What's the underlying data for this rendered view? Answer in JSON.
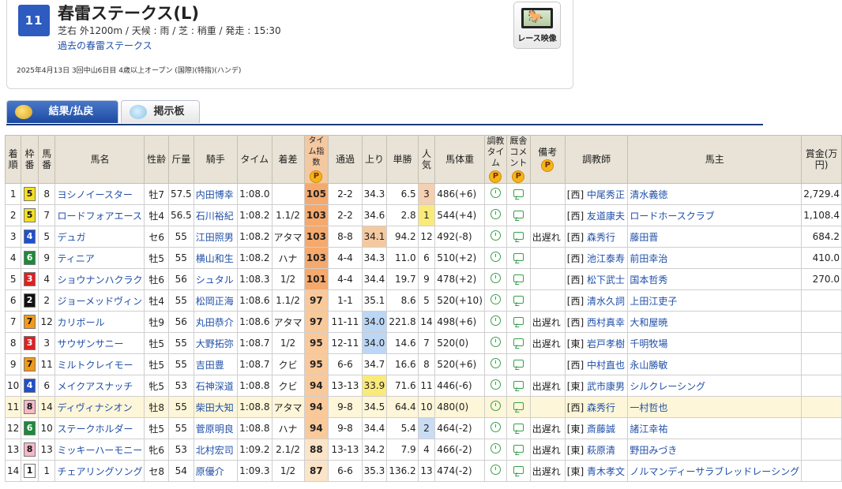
{
  "race": {
    "number": "11 R",
    "title": "春雷ステークス(L)",
    "info": "芝右 外1200m / 天候 : 雨 / 芝 : 稍重 / 発走 : 15:30",
    "past_link": "過去の春雷ステークス",
    "detail": "2025年4月13日  3回中山6日目  4歳以上オープン  (国際)(特指)(ハンデ)",
    "video_label": "レース映像"
  },
  "tabs": [
    {
      "label": "結果/払戻",
      "icon": "coin-icon",
      "active": true
    },
    {
      "label": "掲示板",
      "icon": "speech-bubble-icon",
      "active": false
    }
  ],
  "headers": {
    "rank": "着順",
    "waku": "枠番",
    "umaban": "馬番",
    "horse": "馬名",
    "sexage": "性齢",
    "weight": "斤量",
    "jockey": "騎手",
    "time": "タイム",
    "margin": "着差",
    "index": "タイム指数",
    "passing": "通過",
    "last3f": "上り",
    "odds": "単勝",
    "pop": "人気",
    "bodyweight": "馬体重",
    "train_time": "調教タイム",
    "stable_comment": "厩舎コメント",
    "note": "備考",
    "trainer": "調教師",
    "owner": "馬主",
    "prize": "賞金(万円)",
    "p": "P"
  },
  "colors": {
    "waku": {
      "1": "#ffffff",
      "2": "#111111",
      "3": "#e02020",
      "4": "#1f4fd0",
      "5": "#f5e020",
      "6": "#1b8a3a",
      "7": "#f39a18",
      "8": "#f6b8c8"
    },
    "waku_text": {
      "1": "#111111",
      "2": "#ffffff",
      "3": "#ffffff",
      "4": "#ffffff",
      "5": "#111111",
      "6": "#ffffff",
      "7": "#111111",
      "8": "#111111"
    },
    "index_top": "#f6a96c",
    "index_mid": "#f9c99a",
    "index_low": "#fbe4c7",
    "last3f_fast": "#bcd6f5",
    "last3f_slow": "#f4c9a0",
    "pop1": "#faea7a",
    "pop2": "#c9dcf4",
    "pop3": "#f4cfb0"
  },
  "rows": [
    {
      "rank": "1",
      "waku": "5",
      "num": "8",
      "horse": "ヨシノイースター",
      "sex": "牡7",
      "w": "57.5",
      "jockey": "内田博幸",
      "time": "1:08.0",
      "margin": "",
      "idx": "105",
      "pass": "2-2",
      "l3f": "34.3",
      "odds": "6.5",
      "pop": "3",
      "bw": "486(+6)",
      "tt": true,
      "note": "",
      "region": "[西]",
      "trainer": "中尾秀正",
      "owner": "清水義徳",
      "prize": "2,729.4"
    },
    {
      "rank": "2",
      "waku": "5",
      "num": "7",
      "horse": "ロードフォアエース",
      "sex": "牡4",
      "w": "56.5",
      "jockey": "石川裕紀",
      "time": "1:08.2",
      "margin": "1.1/2",
      "idx": "103",
      "pass": "2-2",
      "l3f": "34.6",
      "odds": "2.8",
      "pop": "1",
      "bw": "544(+4)",
      "tt": true,
      "note": "",
      "region": "[西]",
      "trainer": "友道康夫",
      "owner": "ロードホースクラブ",
      "prize": "1,108.4"
    },
    {
      "rank": "3",
      "waku": "4",
      "num": "5",
      "horse": "デュガ",
      "sex": "セ6",
      "w": "55",
      "jockey": "江田照男",
      "time": "1:08.2",
      "margin": "アタマ",
      "idx": "103",
      "pass": "8-8",
      "l3f": "34.1",
      "odds": "94.2",
      "pop": "12",
      "bw": "492(-8)",
      "tt": true,
      "note": "出遅れ",
      "region": "[西]",
      "trainer": "森秀行",
      "owner": "藤田晋",
      "prize": "684.2"
    },
    {
      "rank": "4",
      "waku": "6",
      "num": "9",
      "horse": "ティニア",
      "sex": "牡5",
      "w": "55",
      "jockey": "横山和生",
      "time": "1:08.2",
      "margin": "ハナ",
      "idx": "103",
      "pass": "4-4",
      "l3f": "34.3",
      "odds": "11.0",
      "pop": "6",
      "bw": "510(+2)",
      "tt": true,
      "note": "",
      "region": "[西]",
      "trainer": "池江泰寿",
      "owner": "前田幸治",
      "prize": "410.0"
    },
    {
      "rank": "5",
      "waku": "3",
      "num": "4",
      "horse": "ショウナンハクラク",
      "sex": "牡6",
      "w": "56",
      "jockey": "シュタル",
      "time": "1:08.3",
      "margin": "1/2",
      "idx": "101",
      "pass": "4-4",
      "l3f": "34.4",
      "odds": "19.7",
      "pop": "9",
      "bw": "478(+2)",
      "tt": true,
      "note": "",
      "region": "[西]",
      "trainer": "松下武士",
      "owner": "国本哲秀",
      "prize": "270.0"
    },
    {
      "rank": "6",
      "waku": "2",
      "num": "2",
      "horse": "ジョーメッドヴィン",
      "sex": "牡4",
      "w": "55",
      "jockey": "松岡正海",
      "time": "1:08.6",
      "margin": "1.1/2",
      "idx": "97",
      "pass": "1-1",
      "l3f": "35.1",
      "odds": "8.6",
      "pop": "5",
      "bw": "520(+10)",
      "tt": true,
      "note": "",
      "region": "[西]",
      "trainer": "清水久詞",
      "owner": "上田江吏子",
      "prize": ""
    },
    {
      "rank": "7",
      "waku": "7",
      "num": "12",
      "horse": "カリボール",
      "sex": "牡9",
      "w": "56",
      "jockey": "丸田恭介",
      "time": "1:08.6",
      "margin": "アタマ",
      "idx": "97",
      "pass": "11-11",
      "l3f": "34.0",
      "odds": "221.8",
      "pop": "14",
      "bw": "498(+6)",
      "tt": true,
      "note": "出遅れ",
      "region": "[西]",
      "trainer": "西村真幸",
      "owner": "大和屋暁",
      "prize": ""
    },
    {
      "rank": "8",
      "waku": "3",
      "num": "3",
      "horse": "サウザンサニー",
      "sex": "牡5",
      "w": "55",
      "jockey": "大野拓弥",
      "time": "1:08.7",
      "margin": "1/2",
      "idx": "95",
      "pass": "12-11",
      "l3f": "34.0",
      "odds": "14.6",
      "pop": "7",
      "bw": "520(0)",
      "tt": true,
      "note": "出遅れ",
      "region": "[東]",
      "trainer": "岩戸孝樹",
      "owner": "千明牧場",
      "prize": ""
    },
    {
      "rank": "9",
      "waku": "7",
      "num": "11",
      "horse": "ミルトクレイモー",
      "sex": "牡5",
      "w": "55",
      "jockey": "吉田豊",
      "time": "1:08.7",
      "margin": "クビ",
      "idx": "95",
      "pass": "6-6",
      "l3f": "34.7",
      "odds": "16.6",
      "pop": "8",
      "bw": "520(+6)",
      "tt": true,
      "note": "",
      "region": "[西]",
      "trainer": "中村直也",
      "owner": "永山勝敏",
      "prize": ""
    },
    {
      "rank": "10",
      "waku": "4",
      "num": "6",
      "horse": "メイクアスナッチ",
      "sex": "牝5",
      "w": "53",
      "jockey": "石神深道",
      "time": "1:08.8",
      "margin": "クビ",
      "idx": "94",
      "pass": "13-13",
      "l3f": "33.9",
      "odds": "71.6",
      "pop": "11",
      "bw": "446(-6)",
      "tt": true,
      "note": "出遅れ",
      "region": "[東]",
      "trainer": "武市康男",
      "owner": "シルクレーシング",
      "prize": ""
    },
    {
      "rank": "11",
      "waku": "8",
      "num": "14",
      "horse": "ディヴィナシオン",
      "sex": "牡8",
      "w": "55",
      "jockey": "柴田大知",
      "time": "1:08.8",
      "margin": "アタマ",
      "idx": "94",
      "pass": "9-8",
      "l3f": "34.5",
      "odds": "64.4",
      "pop": "10",
      "bw": "480(0)",
      "tt": true,
      "note": "",
      "region": "[西]",
      "trainer": "森秀行",
      "owner": "一村哲也",
      "prize": ""
    },
    {
      "rank": "12",
      "waku": "6",
      "num": "10",
      "horse": "ステークホルダー",
      "sex": "牡5",
      "w": "55",
      "jockey": "菅原明良",
      "time": "1:08.8",
      "margin": "ハナ",
      "idx": "94",
      "pass": "9-8",
      "l3f": "34.4",
      "odds": "5.4",
      "pop": "2",
      "bw": "464(-2)",
      "tt": true,
      "note": "出遅れ",
      "region": "[東]",
      "trainer": "斎藤誠",
      "owner": "諸江幸祐",
      "prize": ""
    },
    {
      "rank": "13",
      "waku": "8",
      "num": "13",
      "horse": "ミッキーハーモニー",
      "sex": "牝6",
      "w": "53",
      "jockey": "北村宏司",
      "time": "1:09.2",
      "margin": "2.1/2",
      "idx": "88",
      "pass": "13-13",
      "l3f": "34.2",
      "odds": "7.9",
      "pop": "4",
      "bw": "466(-2)",
      "tt": true,
      "note": "出遅れ",
      "region": "[東]",
      "trainer": "萩原清",
      "owner": "野田みづき",
      "prize": ""
    },
    {
      "rank": "14",
      "waku": "1",
      "num": "1",
      "horse": "チェアリングソング",
      "sex": "セ8",
      "w": "54",
      "jockey": "原優介",
      "time": "1:09.3",
      "margin": "1/2",
      "idx": "87",
      "pass": "6-6",
      "l3f": "35.3",
      "odds": "136.2",
      "pop": "13",
      "bw": "474(-2)",
      "tt": true,
      "note": "出遅れ",
      "region": "[東]",
      "trainer": "青木孝文",
      "owner": "ノルマンディーサラブレッドレーシング",
      "prize": ""
    }
  ]
}
